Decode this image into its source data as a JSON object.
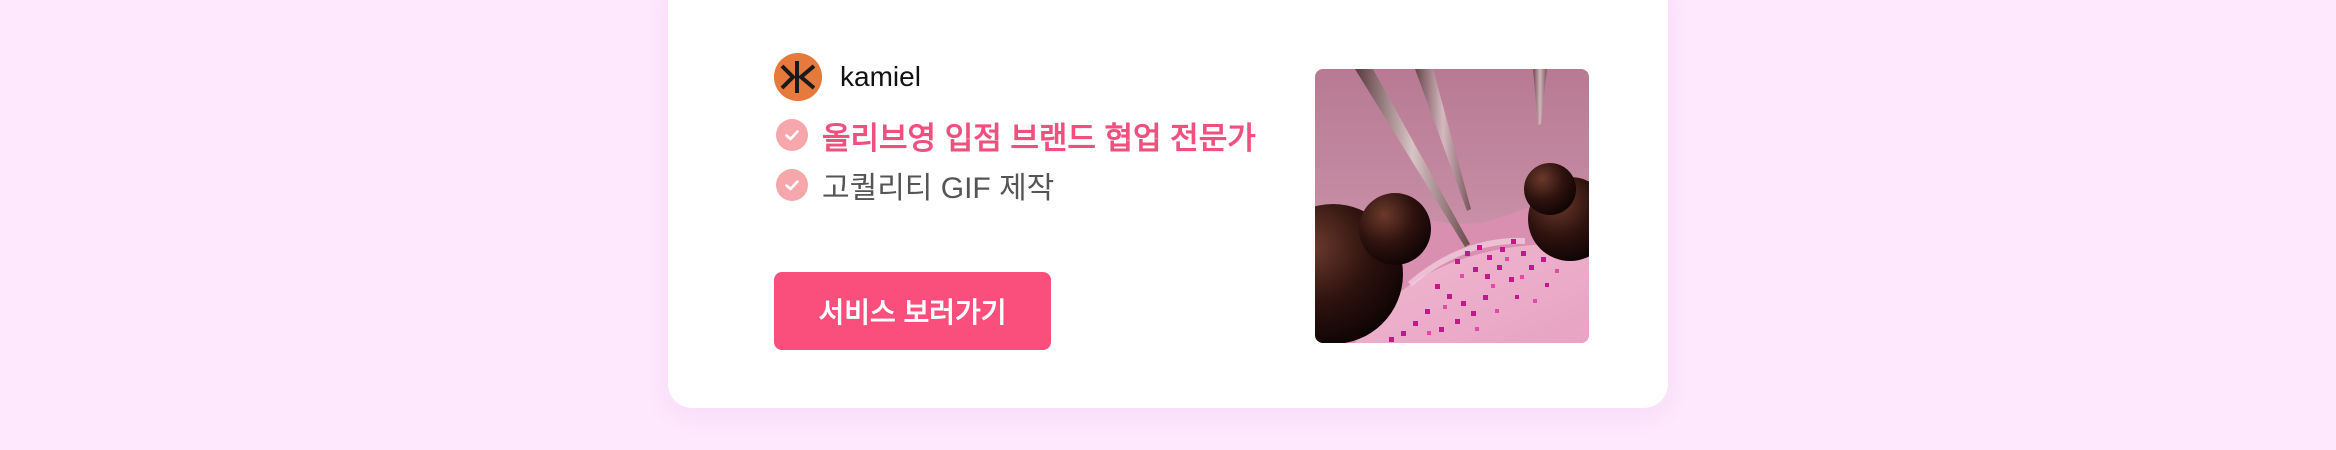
{
  "author": {
    "name": "kamiel",
    "avatar_icon": "kamiel-logo-icon"
  },
  "features": [
    {
      "text": "올리브영 입점 브랜드 협업 전문가",
      "icon": "check-icon",
      "highlight": true
    },
    {
      "text": "고퀄리티 GIF 제작",
      "icon": "check-icon",
      "highlight": false
    }
  ],
  "cta": {
    "label": "서비스 보러가기"
  },
  "thumbnail": {
    "icon": "3d-render-thumbnail"
  },
  "colors": {
    "background": "#fde8fd",
    "card": "#ffffff",
    "accent": "#fa4f7c",
    "highlight_text": "#f0507e",
    "check": "#f6a7ab",
    "avatar": "#e67a3c"
  }
}
